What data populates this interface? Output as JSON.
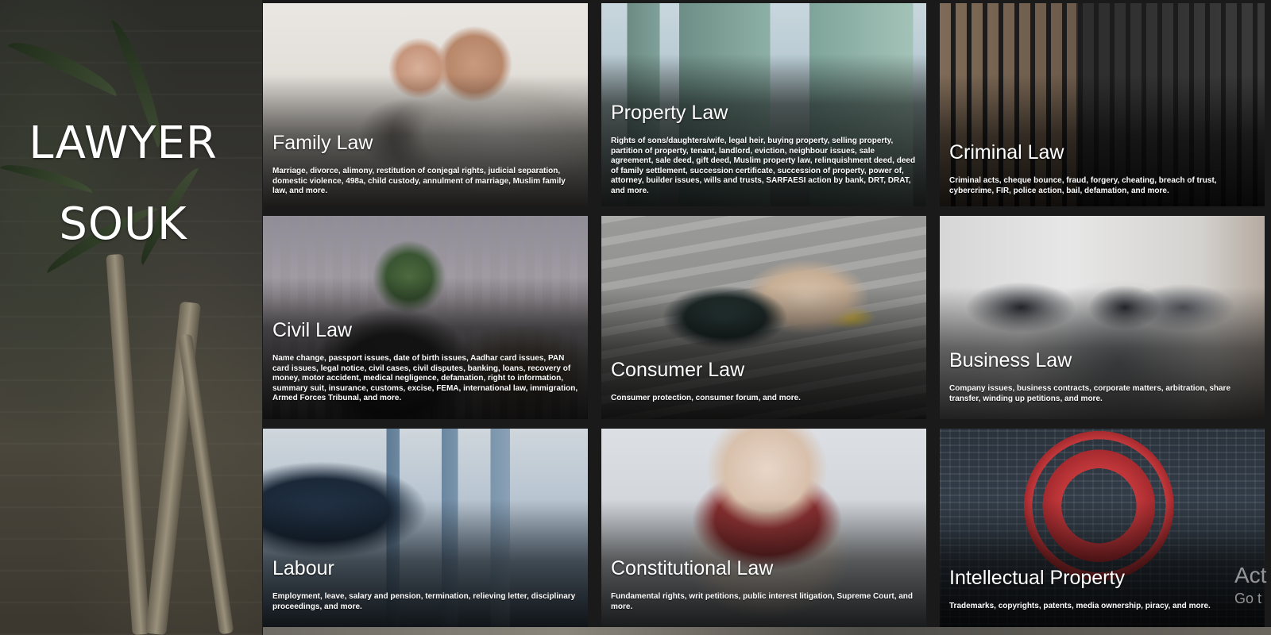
{
  "brand": {
    "line1": "LAWYER",
    "line2": "SOUK"
  },
  "cards": [
    {
      "title": "Family Law",
      "description": "Marriage, divorce, alimony, restitution of conjegal rights, judicial separation, domestic violence, 498a, child custody, annulment of marriage, Muslim family law, and more."
    },
    {
      "title": "Property Law",
      "description": "Rights of sons/daughters/wife, legal heir, buying property, selling property, partition of property, tenant, landlord, eviction, neighbour issues, sale agreement, sale deed, gift deed, Muslim property law, relinquishment deed, deed of family settlement, succession certificate, succession of property, power of, attorney, builder issues, wills and trusts, SARFAESI action by bank, DRT, DRAT, and more."
    },
    {
      "title": "Criminal Law",
      "description": "Criminal acts, cheque bounce, fraud, forgery, cheating, breach of trust, cybercrime, FIR, police action, bail, defamation, and more."
    },
    {
      "title": "Civil Law",
      "description": "Name change, passport issues, date of birth issues, Aadhar card issues, PAN card issues, legal notice, civil cases, civil disputes, banking, loans, recovery of money, motor accident, medical negligence, defamation, right to information, summary suit, insurance, customs, excise, FEMA, international law, immigration, Armed Forces Tribunal, and more."
    },
    {
      "title": "Consumer Law",
      "description": "Consumer protection, consumer forum, and more."
    },
    {
      "title": "Business Law",
      "description": "Company issues, business contracts, corporate matters, arbitration, share transfer, winding up petitions, and more."
    },
    {
      "title": "Labour",
      "description": "Employment, leave, salary and pension, termination, relieving letter, disciplinary proceedings, and more."
    },
    {
      "title": "Constitutional Law",
      "description": "Fundamental rights, writ petitions, public interest litigation, Supreme Court, and more."
    },
    {
      "title": "Intellectual Property",
      "description": "Trademarks, copyrights, patents, media ownership, piracy, and more."
    }
  ],
  "watermark": {
    "line1": "Act",
    "line2": "Go t"
  }
}
